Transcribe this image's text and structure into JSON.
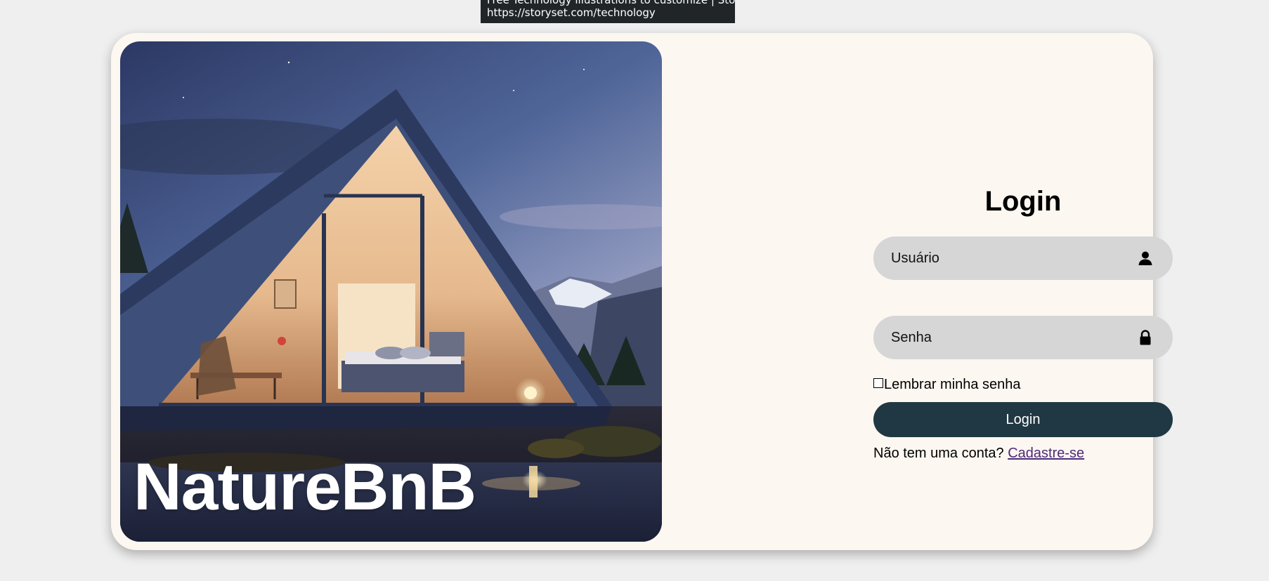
{
  "tooltip": {
    "line1": "Free Technology illustrations to customize | Storyset",
    "line2": "https://storyset.com/technology"
  },
  "hero": {
    "brand": "NatureBnB"
  },
  "login": {
    "title": "Login",
    "username_placeholder": "Usuário",
    "password_placeholder": "Senha",
    "user_icon": "user-icon",
    "lock_icon": "lock-icon",
    "remember_label": "Lembrar minha senha",
    "submit_label": "Login",
    "signup_prompt": "Não tem uma conta?",
    "signup_link": "Cadastre-se"
  },
  "colors": {
    "page_bg": "#efefef",
    "card_bg": "#fcf7f1",
    "input_bg": "#d6d6d6",
    "button_bg": "#203843",
    "link": "#4e2a7a"
  }
}
